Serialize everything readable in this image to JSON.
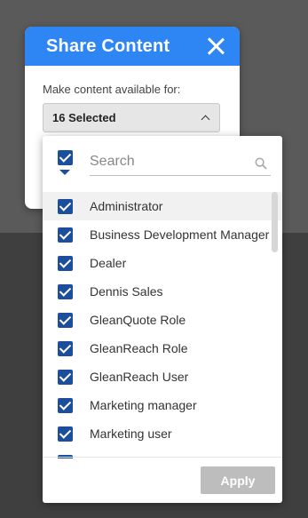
{
  "modal": {
    "title": "Share Content",
    "field_label": "Make content available for:",
    "selected_text": "16 Selected"
  },
  "dropdown": {
    "search_placeholder": "Search",
    "items": [
      {
        "label": "Administrator",
        "checked": true
      },
      {
        "label": "Business Development Manager",
        "checked": true
      },
      {
        "label": "Dealer",
        "checked": true
      },
      {
        "label": "Dennis Sales",
        "checked": true
      },
      {
        "label": "GleanQuote Role",
        "checked": true
      },
      {
        "label": "GleanReach Role",
        "checked": true
      },
      {
        "label": "GleanReach User",
        "checked": true
      },
      {
        "label": "Marketing manager",
        "checked": true
      },
      {
        "label": "Marketing user",
        "checked": true
      }
    ],
    "apply_label": "Apply"
  },
  "colors": {
    "header": "#2e86f5",
    "checkbox": "#1b4f9c",
    "apply_disabled": "#bdbdbd"
  },
  "icons": [
    "close-icon",
    "chevron-up-icon",
    "select-all-checkbox",
    "search-icon"
  ]
}
